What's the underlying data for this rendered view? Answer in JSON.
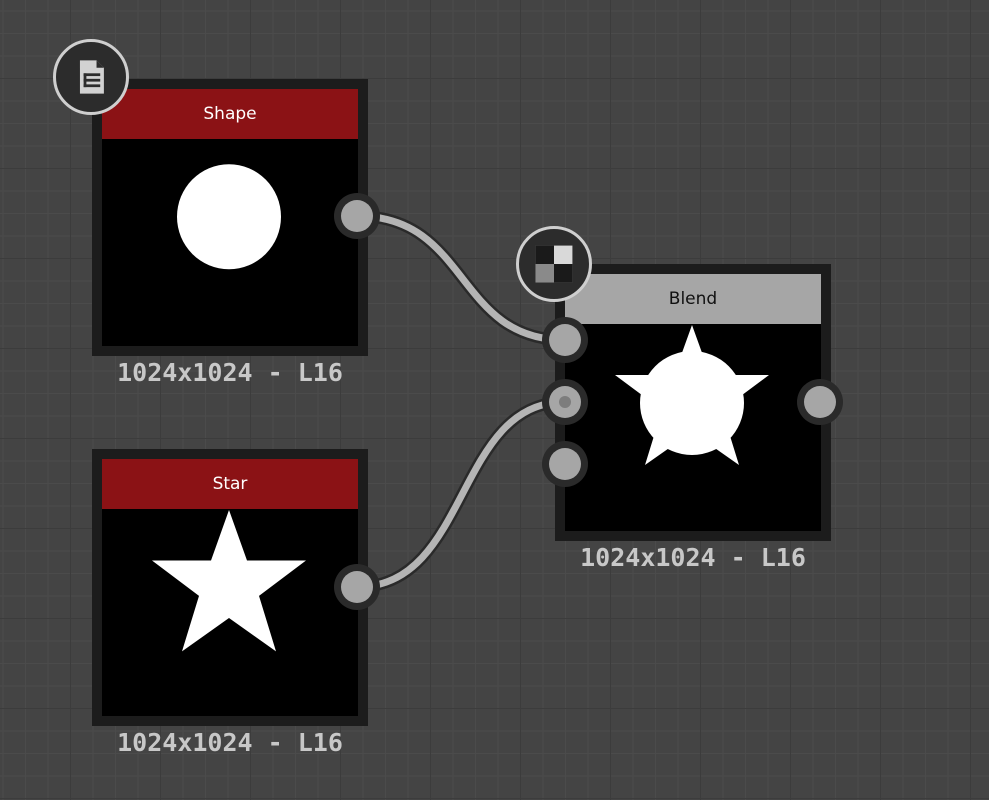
{
  "nodes": {
    "shape": {
      "title": "Shape",
      "caption": "1024x1024 - L16",
      "header_color": "#8b1215",
      "preview": "circle",
      "icon": "document-icon"
    },
    "star": {
      "title": "Star",
      "caption": "1024x1024 - L16",
      "header_color": "#8b1215",
      "preview": "star"
    },
    "blend": {
      "title": "Blend",
      "caption": "1024x1024 - L16",
      "header_color": "#a6a6a6",
      "header_text_color": "#111111",
      "preview": "star-over-circle",
      "icon": "blend-checker-icon"
    }
  },
  "colors": {
    "canvas_background": "#444444",
    "node_frame": "#1c1c1c",
    "wire": "#b4b4b4",
    "port": "#a6a6a6",
    "caption_text": "#c8c8c8"
  }
}
